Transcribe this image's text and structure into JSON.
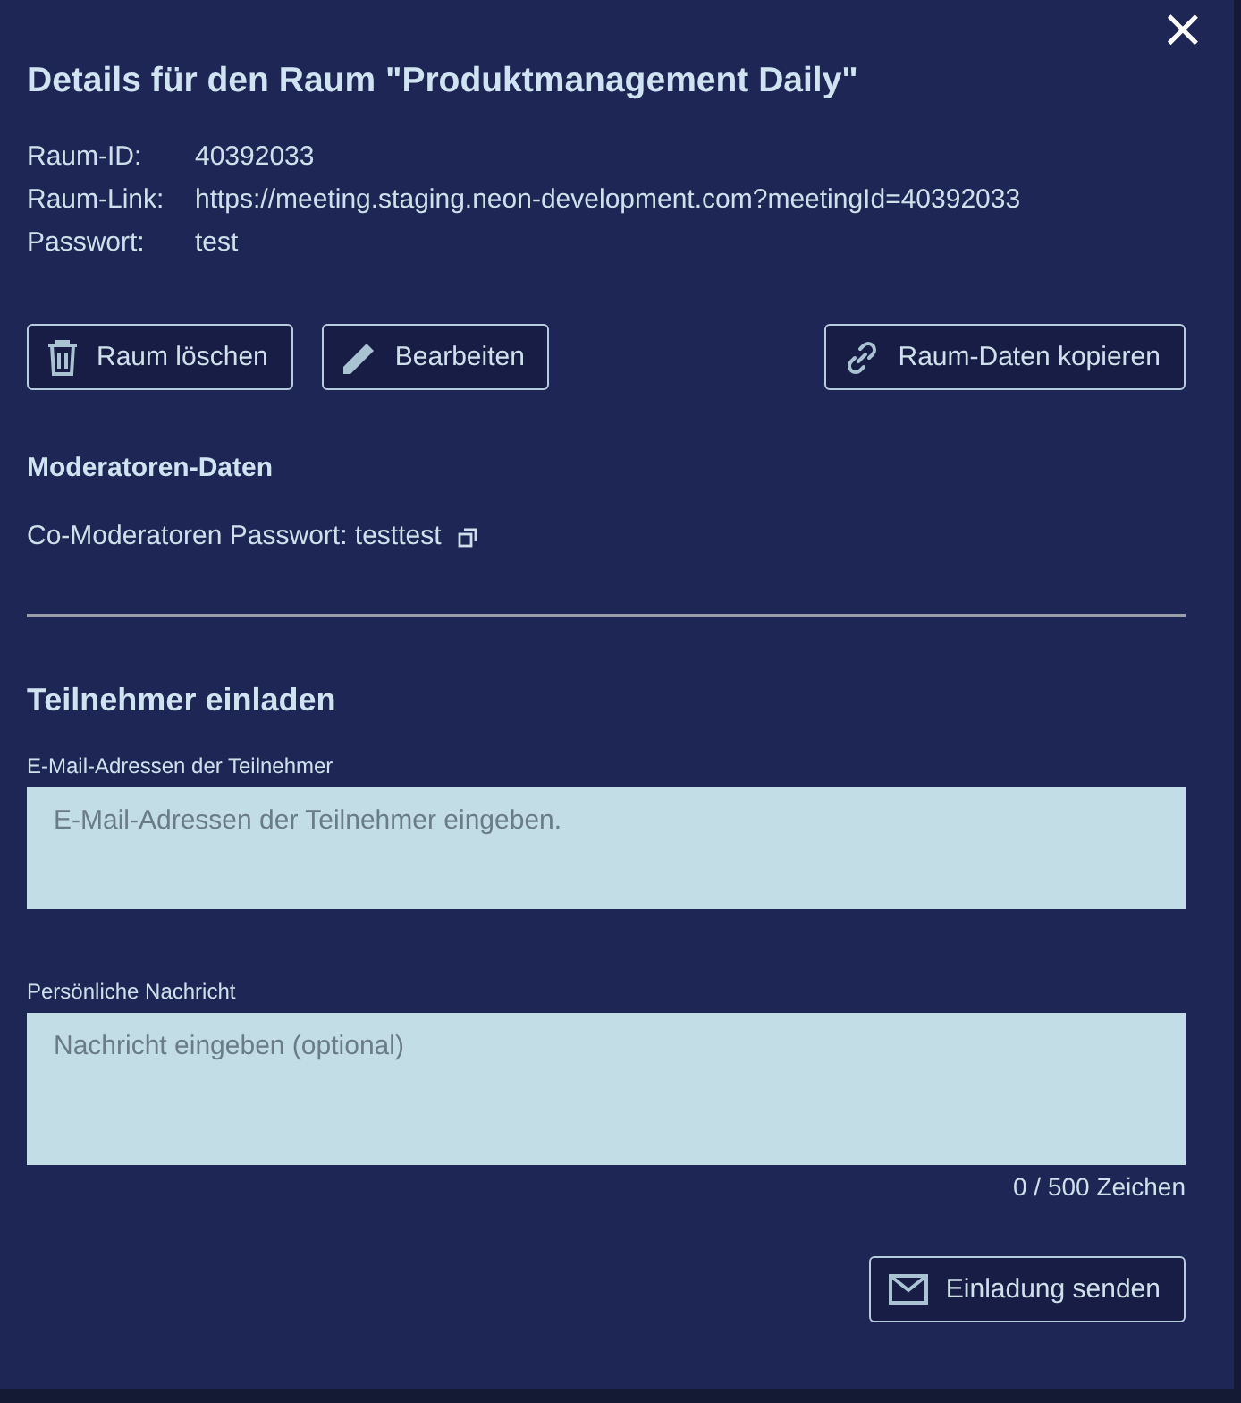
{
  "dialog": {
    "close": "×",
    "title": "Details für den Raum \"Produktmanagement Daily\""
  },
  "info": [
    {
      "label": "Raum-ID:",
      "value": "40392033"
    },
    {
      "label": "Raum-Link:",
      "value": "https://meeting.staging.neon-development.com?meetingId=40392033"
    },
    {
      "label": "Passwort:",
      "value": "test"
    }
  ],
  "actions": [
    {
      "kind": "delete",
      "label": "Raum löschen"
    },
    {
      "kind": "edit",
      "label": "Bearbeiten"
    },
    {
      "kind": "copy",
      "label": "Raum-Daten kopieren"
    }
  ],
  "moderators": {
    "heading": "Moderatoren-Daten",
    "text": "Co-Moderatoren Passwort: testtest"
  },
  "invite": {
    "heading": "Teilnehmer einladen",
    "fields": [
      {
        "label": "E-Mail-Adressen der Teilnehmer",
        "placeholder": "E-Mail-Adressen der Teilnehmer eingeben."
      },
      {
        "label": "Persönliche Nachricht",
        "placeholder": "Nachricht eingeben (optional)"
      }
    ],
    "counter": "0 / 500 Zeichen",
    "send": {
      "label": "Einladung senden"
    }
  }
}
